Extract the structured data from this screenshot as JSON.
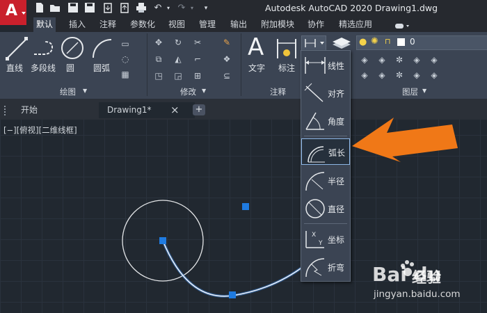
{
  "app": {
    "icon_letter": "A",
    "title": "Autodesk AutoCAD 2020     Drawing1.dwg"
  },
  "menu": [
    "默认",
    "插入",
    "注释",
    "参数化",
    "视图",
    "管理",
    "输出",
    "附加模块",
    "协作",
    "精选应用"
  ],
  "ribbon": {
    "draw": {
      "line": "直线",
      "polyline": "多段线",
      "circle": "圆",
      "arc": "圆弧",
      "title": "绘图"
    },
    "modify": {
      "title": "修改"
    },
    "annotation": {
      "text": "文字",
      "dimension": "标注",
      "title": "注释"
    },
    "layers": {
      "current": "0",
      "title": "图层"
    }
  },
  "tabs": {
    "start": "开始",
    "drawing": "Drawing1*",
    "close": "×",
    "add": "+"
  },
  "viewport_label": "[−][俯视][二维线框]",
  "dimension_menu": [
    {
      "id": "linear",
      "label": "线性",
      "icon": "linear-dim-icon"
    },
    {
      "id": "aligned",
      "label": "对齐",
      "icon": "aligned-dim-icon"
    },
    {
      "id": "angular",
      "label": "角度",
      "icon": "angular-dim-icon"
    },
    {
      "id": "arc",
      "label": "弧长",
      "icon": "arc-length-dim-icon",
      "highlighted": true
    },
    {
      "id": "radius",
      "label": "半径",
      "icon": "radius-dim-icon"
    },
    {
      "id": "diameter",
      "label": "直径",
      "icon": "diameter-dim-icon"
    },
    {
      "id": "ordinate",
      "label": "坐标",
      "icon": "ordinate-dim-icon"
    },
    {
      "id": "jogged",
      "label": "折弯",
      "icon": "jogged-dim-icon"
    }
  ],
  "watermark": {
    "brand": "Bai du",
    "product": "经验",
    "url": "jingyan.baidu.com"
  },
  "colors": {
    "accent_arrow": "#f07817",
    "grip_blue": "#1f7be0",
    "app_red": "#c9202c"
  }
}
